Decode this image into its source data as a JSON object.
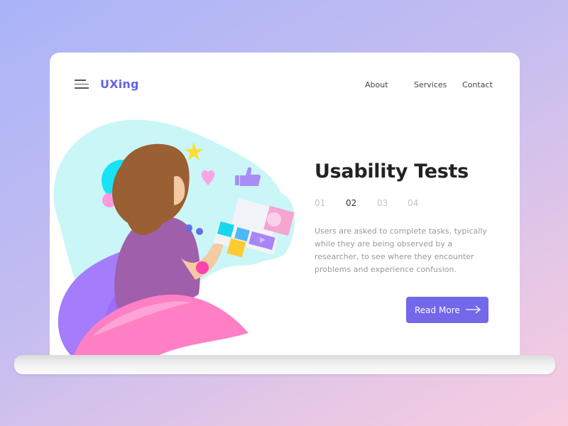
{
  "header": {
    "logo": "UXing",
    "nav": [
      {
        "label": "About"
      },
      {
        "label": "Services"
      },
      {
        "label": "Contact"
      }
    ]
  },
  "hero": {
    "title": "Usability Tests",
    "steps": [
      {
        "label": "01",
        "active": false
      },
      {
        "label": "02",
        "active": true
      },
      {
        "label": "03",
        "active": false
      },
      {
        "label": "04",
        "active": false
      }
    ],
    "description": "Users are asked to complete tasks, typically while they are being observed by a researcher, to see where they encounter problems and experience confusion.",
    "cta": {
      "label": "Read More",
      "icon": "arrow-right-icon"
    }
  },
  "illustration": {
    "subject": "woman using tablet with social app cards",
    "icons": [
      "star-icon",
      "heart-icon",
      "thumbs-up-icon",
      "user-icon",
      "play-icon",
      "music-icon"
    ]
  },
  "colors": {
    "brand": "#5f63e8",
    "button": "#7367ea",
    "title": "#222222",
    "body_text": "#9a9a9a"
  }
}
